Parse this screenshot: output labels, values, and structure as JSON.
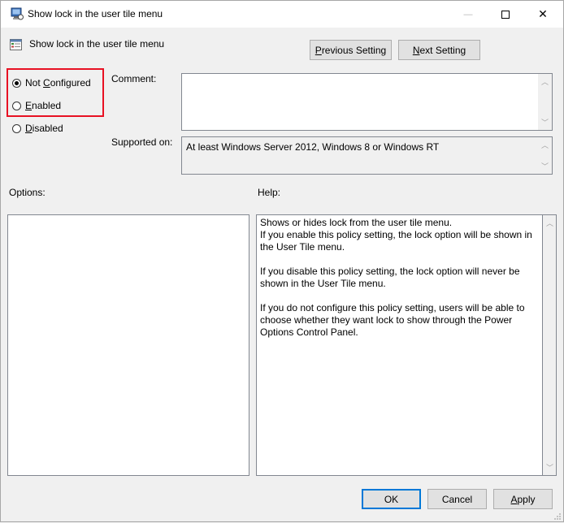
{
  "window": {
    "title": "Show lock in the user tile menu",
    "minimize_glyph": "—",
    "maximize_glyph": "☐",
    "close_glyph": "✕"
  },
  "header": {
    "setting_name": "Show lock in the user tile menu",
    "previous_button_prefix": "",
    "previous_button_underline": "P",
    "previous_button_rest": "revious Setting",
    "next_button_underline": "N",
    "next_button_rest": "ext Setting"
  },
  "state": {
    "options": [
      {
        "label_pre": "Not ",
        "label_u": "C",
        "label_post": "onfigured",
        "checked": true
      },
      {
        "label_pre": "",
        "label_u": "E",
        "label_post": "nabled",
        "checked": false
      },
      {
        "label_pre": "",
        "label_u": "D",
        "label_post": "isabled",
        "checked": false
      }
    ],
    "highlight_color": "#e81123"
  },
  "comment": {
    "label": "Comment:",
    "value": ""
  },
  "supported": {
    "label": "Supported on:",
    "value": "At least Windows Server 2012, Windows 8 or Windows RT"
  },
  "options_panel": {
    "label": "Options:"
  },
  "help_panel": {
    "label": "Help:",
    "paragraphs": [
      "Shows or hides lock from the user tile menu.",
      "If you enable this policy setting, the lock option will be shown in the User Tile menu.",
      "",
      "If you disable this policy setting, the lock option will never be shown in the User Tile menu.",
      "",
      "If you do not configure this policy setting, users will be able to choose whether they want lock to show through the Power Options Control Panel."
    ]
  },
  "footer": {
    "ok_label": "OK",
    "cancel_label": "Cancel",
    "apply_underline": "A",
    "apply_rest": "pply"
  },
  "icons": {
    "app": "policy-setting-icon",
    "setting": "policy-document-icon"
  }
}
